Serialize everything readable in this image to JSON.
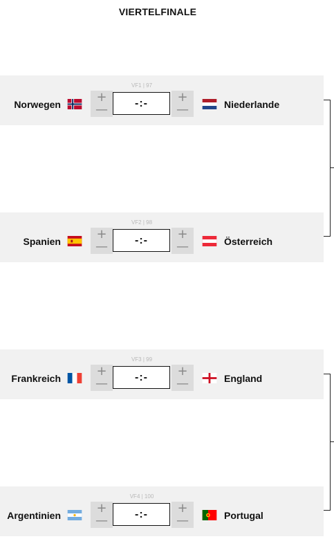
{
  "round_title": "VIERTELFINALE",
  "matches": [
    {
      "label": "VF1 | 97",
      "home": "Norwegen",
      "away": "Niederlande",
      "score": "-:-",
      "home_flag": "norway",
      "away_flag": "netherlands"
    },
    {
      "label": "VF2 | 98",
      "home": "Spanien",
      "away": "Österreich",
      "score": "-:-",
      "home_flag": "spain",
      "away_flag": "austria"
    },
    {
      "label": "VF3 | 99",
      "home": "Frankreich",
      "away": "England",
      "score": "-:-",
      "home_flag": "france",
      "away_flag": "england"
    },
    {
      "label": "VF4 | 100",
      "home": "Argentinien",
      "away": "Portugal",
      "score": "-:-",
      "home_flag": "argentina",
      "away_flag": "portugal"
    }
  ],
  "controls": {
    "plus": "+",
    "minus": "—"
  },
  "colors": {
    "match_background": "#f1f1f1",
    "stepper_background": "#dcdcdc"
  }
}
